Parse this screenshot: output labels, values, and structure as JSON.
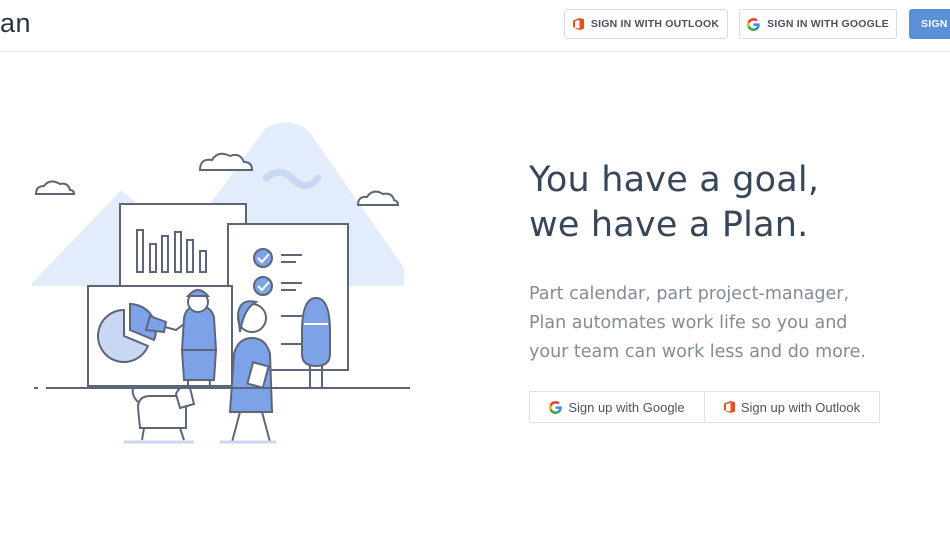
{
  "header": {
    "logo_text": "an",
    "outlook_signin_label": "SIGN IN WITH OUTLOOK",
    "google_signin_label": "SIGN IN WITH GOOGLE",
    "signup_label": "SIGN UP"
  },
  "hero": {
    "headline_line1": "You have a goal,",
    "headline_line2": "we have a Plan.",
    "subtitle_line1": "Part calendar, part project-manager,",
    "subtitle_line2": "Plan automates work life so you and",
    "subtitle_line3": "your team can work less and do more.",
    "google_signup_label": "Sign up with Google",
    "outlook_signup_label": "Sign up with Outlook"
  },
  "icons": {
    "outlook": "office-logo-icon",
    "google": "google-g-icon"
  },
  "colors": {
    "primary": "#5b8fd8",
    "headline": "#384659",
    "subtitle": "#838b96",
    "illustration_blue": "#7ea2e8",
    "illustration_bg": "#e3ecfa",
    "outlook_orange": "#e8501f"
  }
}
